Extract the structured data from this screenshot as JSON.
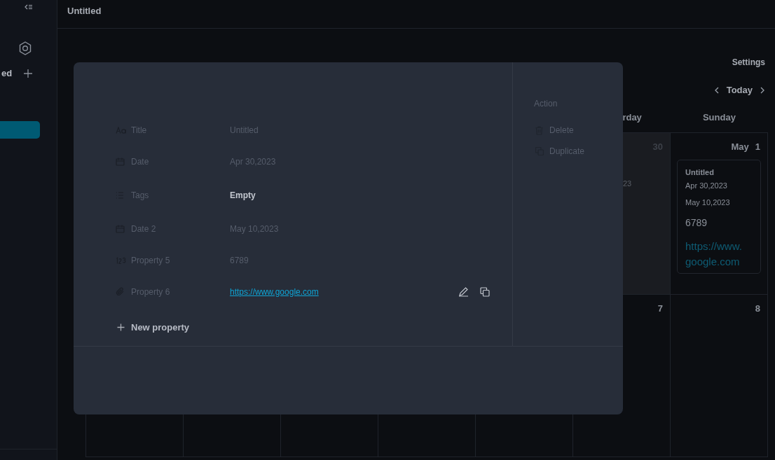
{
  "sidebar": {
    "section_label": "ed",
    "active_item": {
      "selected": true
    }
  },
  "header": {
    "title": "Untitled"
  },
  "toolbar": {
    "settings": "Settings",
    "today": "Today"
  },
  "calendar": {
    "day_headers": [
      {
        "label": "rday"
      },
      {
        "label": "Sunday"
      }
    ],
    "cells": [
      {
        "day": "30",
        "shaded": true,
        "fragment": "23"
      },
      {
        "day": "1",
        "month": "May",
        "shaded": false,
        "event": {
          "title": "Untitled",
          "date": "Apr 30,2023",
          "date2": "May 10,2023",
          "number": "6789",
          "url": "https://www.google.com"
        }
      },
      {
        "day": "7",
        "shaded": false
      },
      {
        "day": "8",
        "shaded": false
      }
    ]
  },
  "dialog": {
    "properties": [
      {
        "kind": "title",
        "label": "Title",
        "value": "Untitled"
      },
      {
        "kind": "date",
        "label": "Date",
        "value": "Apr 30,2023"
      },
      {
        "kind": "tags",
        "label": "Tags",
        "placeholder": "Empty"
      },
      {
        "kind": "date",
        "label": "Date 2",
        "value": "May 10,2023"
      },
      {
        "kind": "number",
        "label": "Property 5",
        "value": "6789"
      },
      {
        "kind": "url",
        "label": "Property 6",
        "value": "https://www.google.com"
      }
    ],
    "new_property": "New property",
    "actions_heading": "Action",
    "actions": [
      {
        "kind": "delete",
        "label": "Delete"
      },
      {
        "kind": "duplicate",
        "label": "Duplicate"
      }
    ]
  }
}
